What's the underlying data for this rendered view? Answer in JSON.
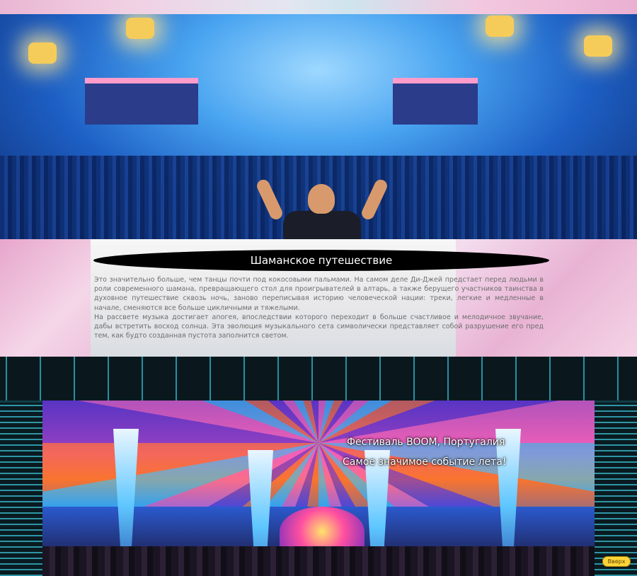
{
  "colors": {
    "title_bar_bg": "#000000",
    "title_text": "#ffffff",
    "body_text": "#6e6e6e",
    "up_button": "#ffd43a",
    "pink_background": "#e9b3d4"
  },
  "hero": {
    "image": "concert-dj-crowd-photo"
  },
  "article": {
    "title": "Шаманское путешествие",
    "paragraph1": "Это значительно больше, чем танцы почти под кокосовыми пальмами. На самом деле Ди-Джей предстает перед людьми в роли современного шамана, превращающего стол для проигрывателей в алтарь, а также берущего участников таинства в духовное путешествие сквозь ночь, заново переписывая историю человеческой нации: треки, легкие и медленные в начале, сменяются все больше цикличными и тяжелыми.",
    "paragraph2": "На рассвете музыка достигает апогея, впоследствии которого переходит в больше счастливое и мелодичное звучание, дабы встретить восход солнца. Эта эволюция музыкального сета символически представляет собой разрушение его пред тем, как будто созданная пустота заполнится светом."
  },
  "festival": {
    "image": "boom-festival-stage-photo",
    "caption_line1": "Фестиваль BOOM, Португалия",
    "caption_line2": "Самое значимое событие лета!"
  },
  "up_button": {
    "label": "Вверх",
    "icon": "arrow-up-icon"
  }
}
